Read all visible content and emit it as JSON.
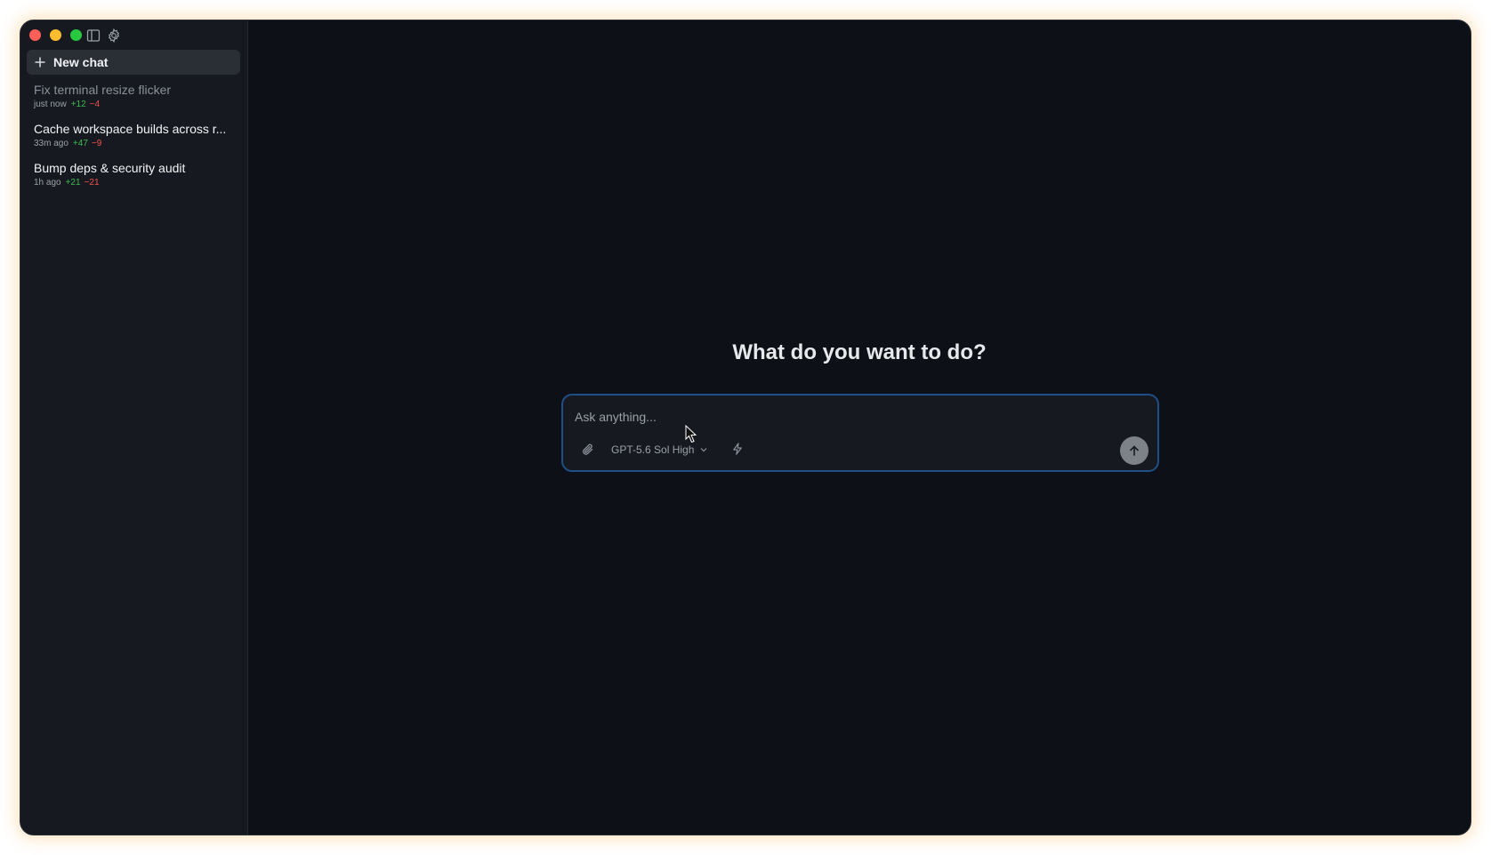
{
  "sidebar": {
    "new_chat_label": "New chat",
    "chats": [
      {
        "title": "Fix terminal resize flicker",
        "time": "just now",
        "added": "+12",
        "removed": "−4"
      },
      {
        "title": "Cache workspace builds across r...",
        "time": "33m ago",
        "added": "+47",
        "removed": "−9"
      },
      {
        "title": "Bump deps & security audit",
        "time": "1h ago",
        "added": "+21",
        "removed": "−21"
      }
    ]
  },
  "main": {
    "heading": "What do you want to do?",
    "composer": {
      "placeholder": "Ask anything...",
      "value": "",
      "model_label": "GPT-5.6 Sol High"
    }
  },
  "icons": {
    "sidebar_toggle": "sidebar-toggle-icon",
    "settings": "gear-icon",
    "new_chat": "plus-icon",
    "attach": "paperclip-icon",
    "model_dropdown": "chevron-down-icon",
    "mode": "lightning-icon",
    "send": "arrow-up-icon"
  },
  "colors": {
    "window_bg": "#0d1117",
    "sidebar_bg": "#161a20",
    "composer_border": "#1f4f86",
    "added": "#3fb950",
    "removed": "#f85149"
  }
}
